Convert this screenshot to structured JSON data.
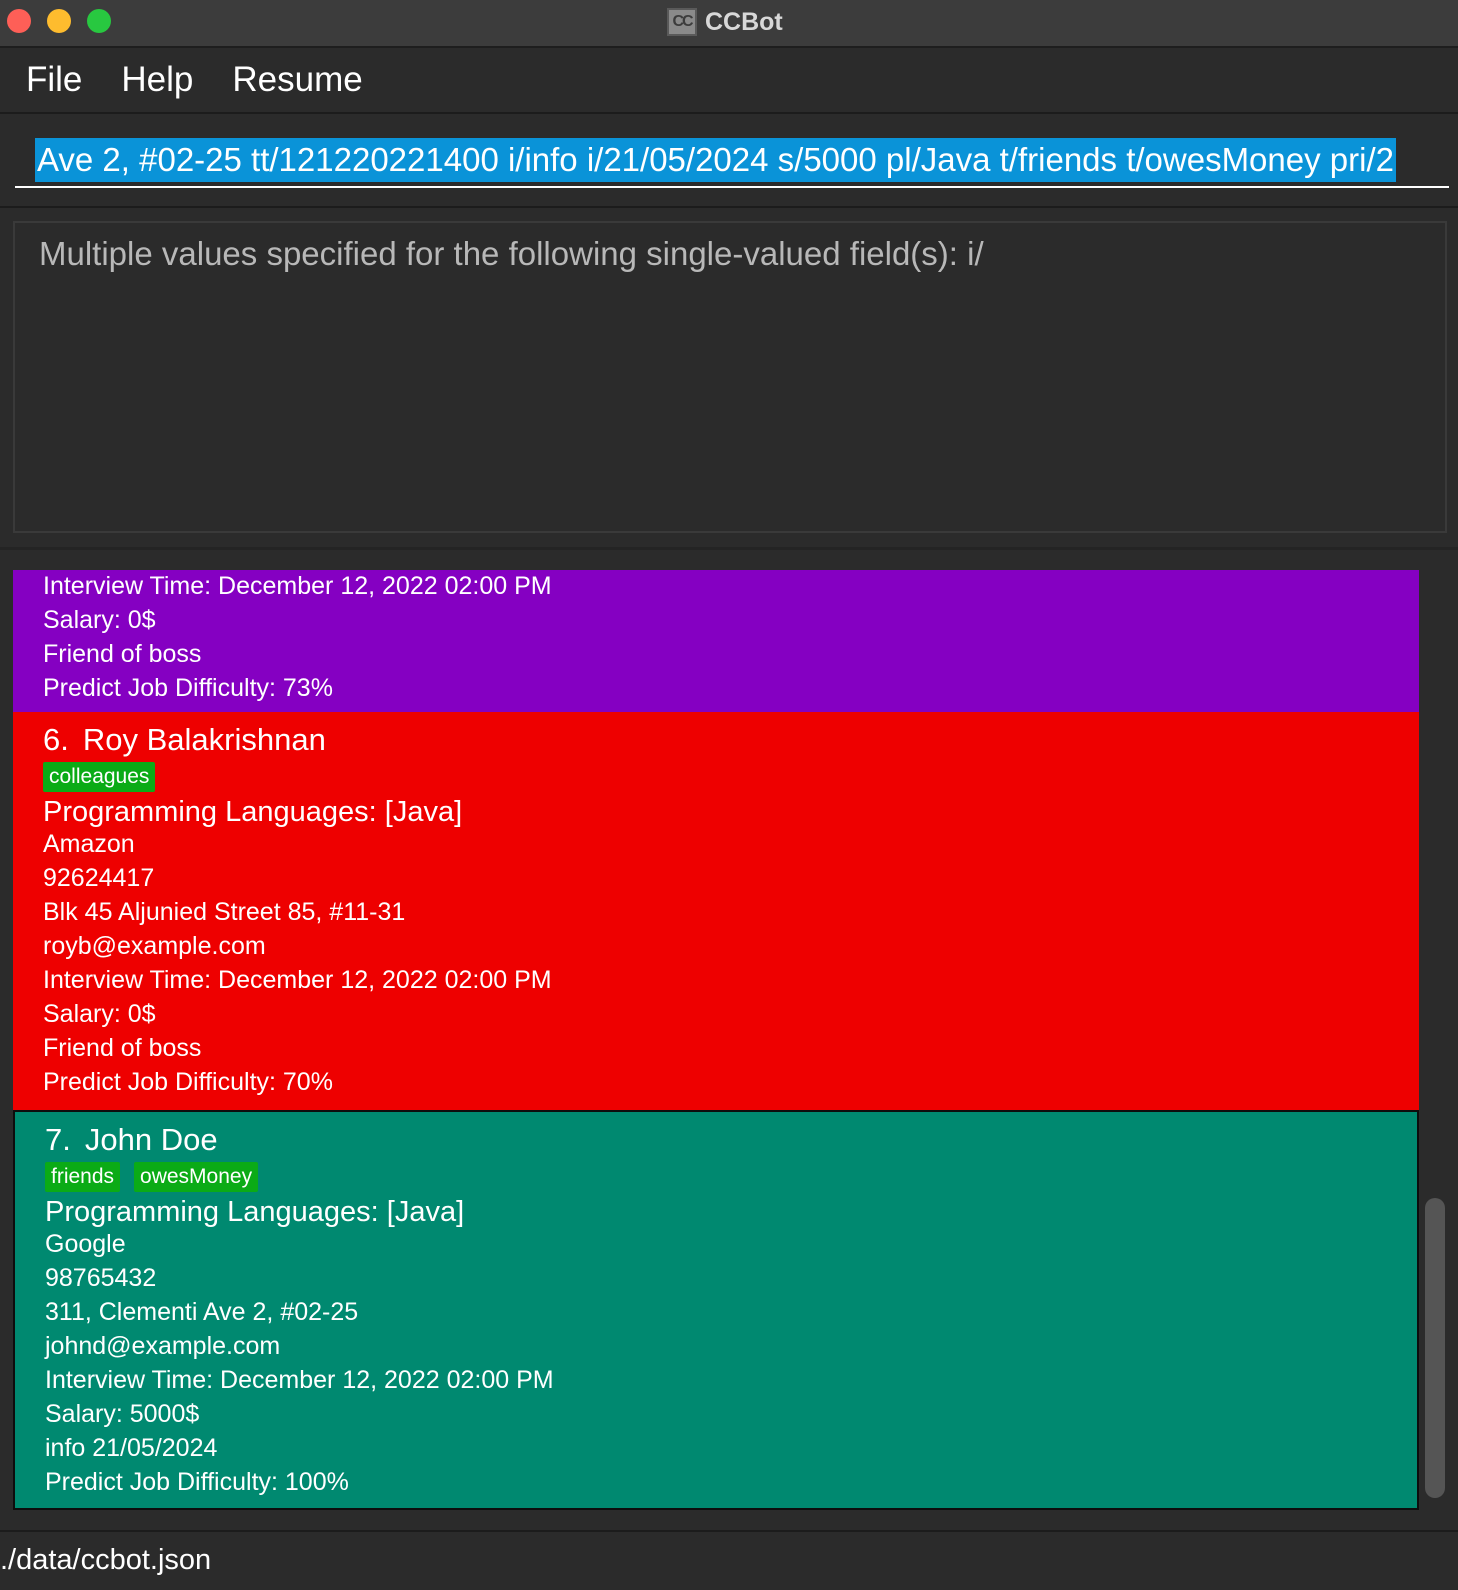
{
  "window": {
    "title": "CCBot",
    "icon_text": "CC"
  },
  "menu": {
    "file": "File",
    "help": "Help",
    "resume": "Resume"
  },
  "command": {
    "value": "Ave 2, #02-25 tt/121220221400 i/info i/21/05/2024 s/5000 pl/Java t/friends t/owesMoney pri/2"
  },
  "result": {
    "message": "Multiple values specified for the following single-valued field(s): i/"
  },
  "cards": {
    "partial": {
      "color": "#8500c2",
      "interview": "Interview Time: December 12, 2022 02:00 PM",
      "salary": "Salary: 0$",
      "info": "Friend of boss",
      "difficulty": "Predict Job Difficulty: 73%"
    },
    "roy": {
      "color": "#ee0000",
      "index": "6.",
      "name": "Roy Balakrishnan",
      "tags": [
        "colleagues"
      ],
      "languages": "Programming Languages: [Java]",
      "company": "Amazon",
      "phone": "92624417",
      "address": "Blk 45 Aljunied Street 85, #11-31",
      "email": "royb@example.com",
      "interview": "Interview Time: December 12, 2022 02:00 PM",
      "salary": "Salary: 0$",
      "info": "Friend of boss",
      "difficulty": "Predict Job Difficulty: 70%"
    },
    "john": {
      "color": "#008970",
      "index": "7.",
      "name": "John Doe",
      "tags": [
        "friends",
        "owesMoney"
      ],
      "languages": "Programming Languages: [Java]",
      "company": "Google",
      "phone": "98765432",
      "address": "311, Clementi Ave 2, #02-25",
      "email": "johnd@example.com",
      "interview": "Interview Time: December 12, 2022 02:00 PM",
      "salary": "Salary: 5000$",
      "info": "info 21/05/2024",
      "difficulty": "Predict Job Difficulty: 100%"
    }
  },
  "status": {
    "path": "./data/ccbot.json"
  }
}
